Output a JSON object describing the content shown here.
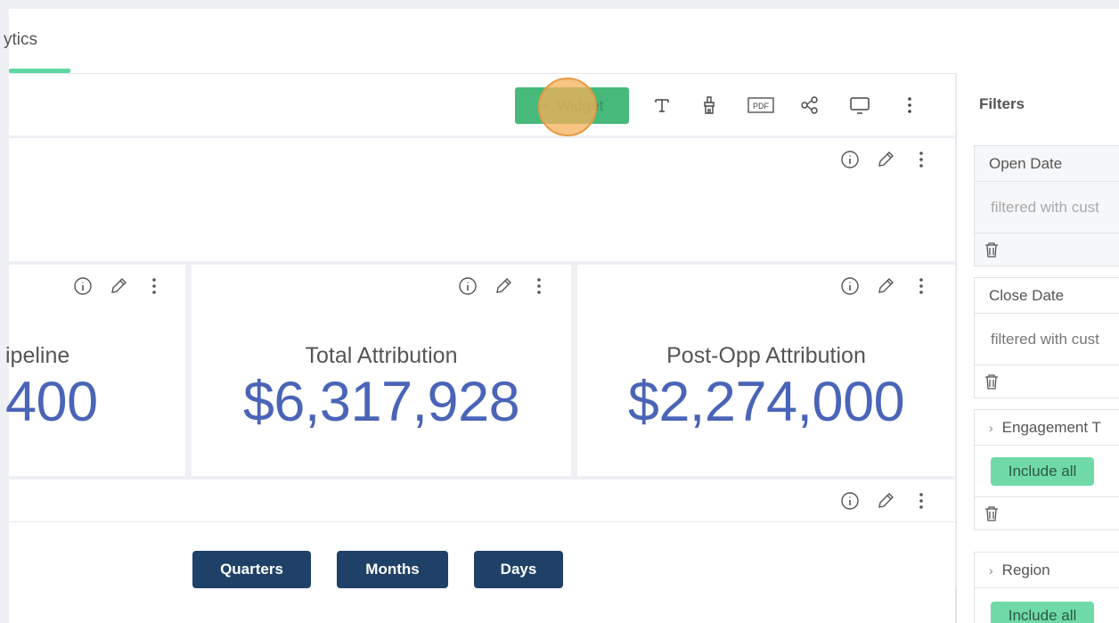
{
  "tab": {
    "label": "ytics",
    "accent": "#5fd7a3"
  },
  "toolbar": {
    "add_widget_plus": "+",
    "add_widget_label": "Widget",
    "button_color": "#47b97a",
    "icons": [
      "text-icon",
      "paint-brush-icon",
      "pdf-icon",
      "share-icon",
      "monitor-icon",
      "more-vertical-icon"
    ],
    "pdf_text": "PDF"
  },
  "metrics": [
    {
      "label": "ipeline",
      "value": "400"
    },
    {
      "label": "Total Attribution",
      "value": "$6,317,928"
    },
    {
      "label": "Post-Opp Attribution",
      "value": "$2,274,000"
    }
  ],
  "range_buttons": [
    "Quarters",
    "Months",
    "Days"
  ],
  "filters": {
    "title": "Filters",
    "items": [
      {
        "head": "Open Date",
        "body": "filtered with cust"
      },
      {
        "head": "Close Date",
        "body": "filtered with cust"
      },
      {
        "head": "Engagement T",
        "chevron": "›",
        "button": "Include all"
      },
      {
        "head": "Region",
        "chevron": "›",
        "button": "Include all"
      }
    ]
  },
  "colors": {
    "value_blue": "#4a64b8",
    "range_button": "#1f4168",
    "include_green": "#6fdaa7"
  }
}
